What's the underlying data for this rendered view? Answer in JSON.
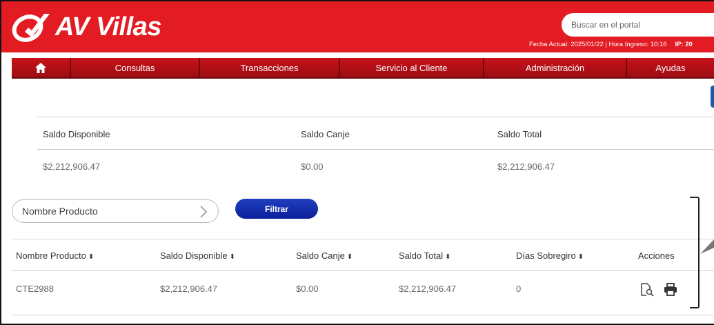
{
  "brand": {
    "name": "AV Villas",
    "header_color": "#e31b23"
  },
  "search": {
    "placeholder": "Buscar en el portal"
  },
  "meta": {
    "date_info": "Fecha Actual: 2025/01/22 | Hora Ingreso: 10:16",
    "ip": "IP: 20"
  },
  "nav": {
    "home_icon": "home-icon",
    "items": [
      "Consultas",
      "Transacciones",
      "Servicio al Cliente",
      "Administración",
      "Ayudas"
    ]
  },
  "summary": {
    "labels": [
      "Saldo Disponible",
      "Saldo Canje",
      "Saldo Total"
    ],
    "values": [
      "$2,212,906.47",
      "$0.00",
      "$2,212,906.47"
    ]
  },
  "filter": {
    "placeholder": "Nombre Producto",
    "button": "Filtrar"
  },
  "table": {
    "headers": [
      "Nombre Producto",
      "Saldo Disponible",
      "Saldo Canje",
      "Saldo Total",
      "Días Sobregiro",
      "Acciones"
    ],
    "sort_glyph": "⬍",
    "rows": [
      {
        "producto": "CTE2988",
        "disponible": "$2,212,906.47",
        "canje": "$0.00",
        "total": "$2,212,906.47",
        "dias": "0"
      }
    ]
  },
  "icons": {
    "detail": "document-search-icon",
    "print": "printer-icon"
  }
}
